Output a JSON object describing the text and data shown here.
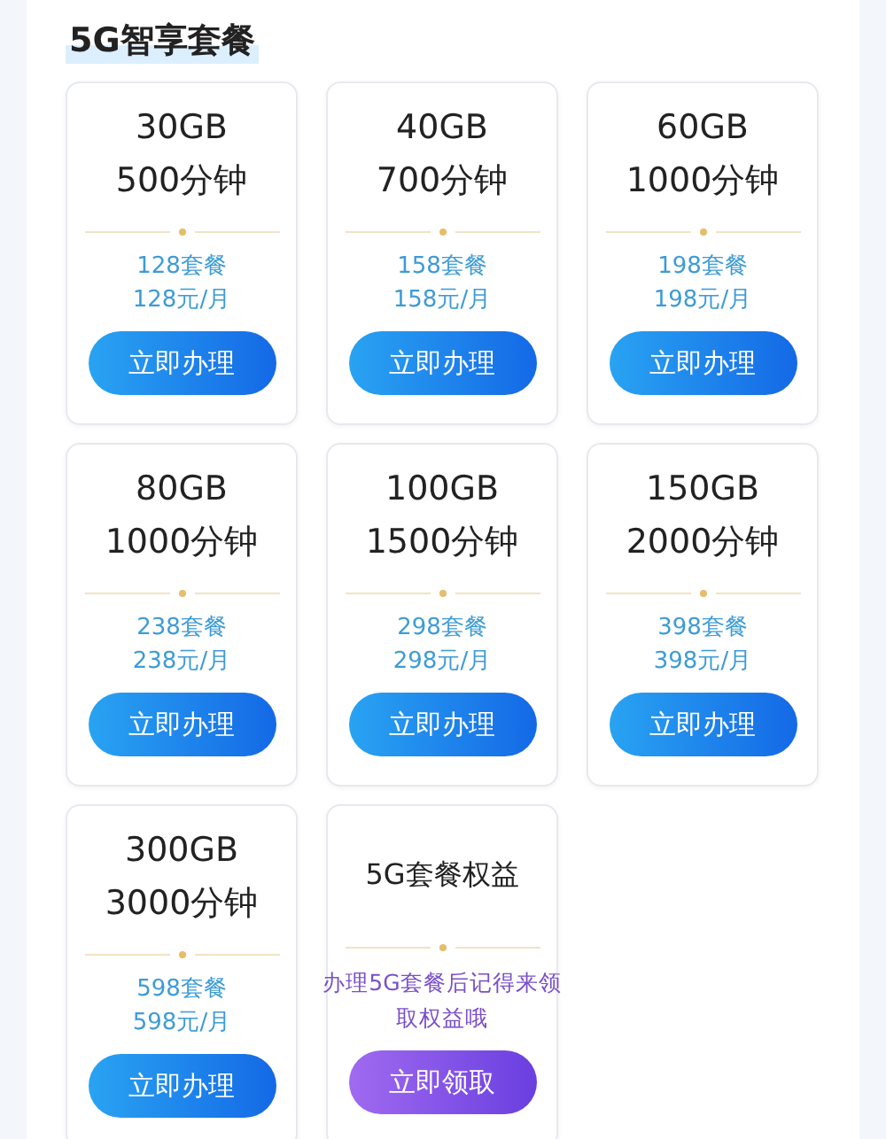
{
  "title": "5G智享套餐",
  "cards": [
    {
      "kind": "plan",
      "data": "30GB",
      "minutes": "500分钟",
      "package": "128套餐",
      "price": "128元/月",
      "button": "立即办理"
    },
    {
      "kind": "plan",
      "data": "40GB",
      "minutes": "700分钟",
      "package": "158套餐",
      "price": "158元/月",
      "button": "立即办理"
    },
    {
      "kind": "plan",
      "data": "60GB",
      "minutes": "1000分钟",
      "package": "198套餐",
      "price": "198元/月",
      "button": "立即办理"
    },
    {
      "kind": "plan",
      "data": "80GB",
      "minutes": "1000分钟",
      "package": "238套餐",
      "price": "238元/月",
      "button": "立即办理"
    },
    {
      "kind": "plan",
      "data": "100GB",
      "minutes": "1500分钟",
      "package": "298套餐",
      "price": "298元/月",
      "button": "立即办理"
    },
    {
      "kind": "plan",
      "data": "150GB",
      "minutes": "2000分钟",
      "package": "398套餐",
      "price": "398元/月",
      "button": "立即办理"
    },
    {
      "kind": "plan",
      "data": "300GB",
      "minutes": "3000分钟",
      "package": "598套餐",
      "price": "598元/月",
      "button": "立即办理"
    },
    {
      "kind": "benefit",
      "heading": "5G套餐权益",
      "note": "办理5G套餐后记得来领取权益哦",
      "button": "立即领取"
    }
  ]
}
